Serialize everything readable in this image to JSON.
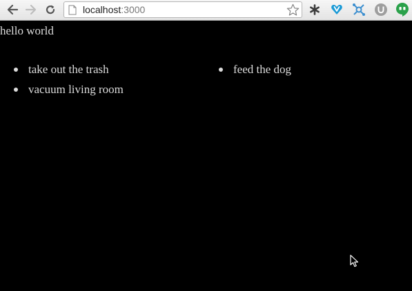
{
  "browser": {
    "url_host": "localhost",
    "url_port": ":3000",
    "icons": {
      "back": "back-arrow-icon",
      "forward": "forward-arrow-icon",
      "reload": "reload-icon",
      "page": "page-icon",
      "bookmark": "star-icon",
      "extensions": [
        "asterisk-extension-icon",
        "heart-extension-icon",
        "molecule-extension-icon",
        "u-extension-icon",
        "hangouts-extension-icon"
      ]
    },
    "extension_u_label": "U"
  },
  "page": {
    "heading": "hello world",
    "left_list": [
      "take out the trash",
      "vacuum living room"
    ],
    "right_list": [
      "feed the dog"
    ]
  },
  "colors": {
    "page_background": "#000000",
    "text": "#dcdcdc"
  }
}
